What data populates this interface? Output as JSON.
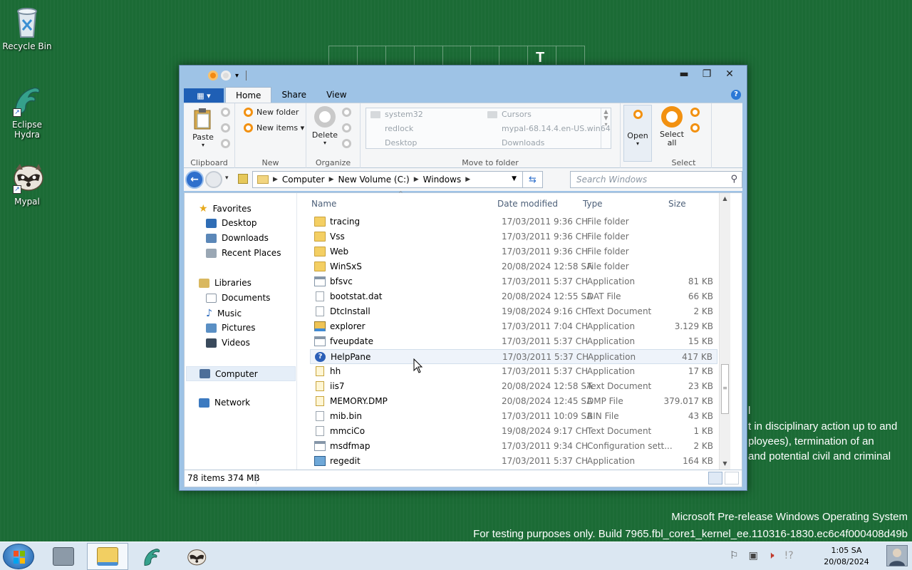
{
  "desktop": {
    "icons": [
      {
        "label": "Recycle Bin",
        "icon": "recycle-bin-icon"
      },
      {
        "label": "Eclipse Hydra",
        "icon": "eclipse-hydra-icon"
      },
      {
        "label": "Mypal",
        "icon": "mypal-raccoon-icon"
      }
    ],
    "bg_letter": "T",
    "bg_lines": [
      "l",
      "t in disciplinary action up to and",
      "ployees), termination of an",
      "and potential civil and criminal"
    ],
    "watermark_line1": "Microsoft Pre-release Windows Operating System",
    "watermark_line2": "For testing purposes only. Build 7965.fbl_core1_kernel_ee.110316-1830.ec6c4f000408d49b"
  },
  "window": {
    "title_buttons": {
      "minimize": "▬",
      "maximize": "❐",
      "close": "✕"
    },
    "ribbon_tabs": {
      "file": "▦ ▾",
      "home": "Home",
      "share": "Share",
      "view": "View"
    },
    "clipboard": {
      "paste": "Paste",
      "group": "Clipboard"
    },
    "new": {
      "new_folder": "New folder",
      "new_items": "New items ▾",
      "group": "New"
    },
    "organize": {
      "delete": "Delete",
      "group": "Organize"
    },
    "move_to": {
      "group": "Move to folder",
      "items": [
        "system32",
        "redlock",
        "Desktop",
        "Cursors",
        "mypal-68.14.4.en-US.win64",
        "Downloads"
      ]
    },
    "select": {
      "open": "Open",
      "select_all_1": "Select",
      "select_all_2": "all",
      "group": "Select"
    },
    "address": {
      "crumbs": [
        "Computer",
        "New Volume (C:)",
        "Windows"
      ],
      "search_placeholder": "Search Windows"
    },
    "nav_pane": {
      "favorites": "Favorites",
      "desktop": "Desktop",
      "downloads": "Downloads",
      "recent": "Recent Places",
      "libraries": "Libraries",
      "documents": "Documents",
      "music": "Music",
      "pictures": "Pictures",
      "videos": "Videos",
      "computer": "Computer",
      "network": "Network"
    },
    "columns": {
      "name": "Name",
      "date": "Date modified",
      "type": "Type",
      "size": "Size"
    },
    "files": [
      {
        "name": "tracing",
        "date": "17/03/2011 9:36 CH",
        "type": "File folder",
        "size": "",
        "icon": "folder"
      },
      {
        "name": "Vss",
        "date": "17/03/2011 9:36 CH",
        "type": "File folder",
        "size": "",
        "icon": "folder"
      },
      {
        "name": "Web",
        "date": "17/03/2011 9:36 CH",
        "type": "File folder",
        "size": "",
        "icon": "folder"
      },
      {
        "name": "WinSxS",
        "date": "20/08/2024 12:58 SA",
        "type": "File folder",
        "size": "",
        "icon": "folder"
      },
      {
        "name": "bfsvc",
        "date": "17/03/2011 5:37 CH",
        "type": "Application",
        "size": "81 KB",
        "icon": "app"
      },
      {
        "name": "bootstat.dat",
        "date": "20/08/2024 12:55 SA",
        "type": "DAT File",
        "size": "66 KB",
        "icon": "doc"
      },
      {
        "name": "DtcInstall",
        "date": "19/08/2024 9:16 CH",
        "type": "Text Document",
        "size": "2 KB",
        "icon": "doc"
      },
      {
        "name": "explorer",
        "date": "17/03/2011 7:04 CH",
        "type": "Application",
        "size": "3.129 KB",
        "icon": "explorer"
      },
      {
        "name": "fveupdate",
        "date": "17/03/2011 5:37 CH",
        "type": "Application",
        "size": "15 KB",
        "icon": "app"
      },
      {
        "name": "HelpPane",
        "date": "17/03/2011 5:37 CH",
        "type": "Application",
        "size": "417 KB",
        "icon": "help"
      },
      {
        "name": "hh",
        "date": "17/03/2011 5:37 CH",
        "type": "Application",
        "size": "17 KB",
        "icon": "lock"
      },
      {
        "name": "iis7",
        "date": "20/08/2024 12:58 SA",
        "type": "Text Document",
        "size": "23 KB",
        "icon": "lock"
      },
      {
        "name": "MEMORY.DMP",
        "date": "20/08/2024 12:45 SA",
        "type": "DMP File",
        "size": "379.017 KB",
        "icon": "lock"
      },
      {
        "name": "mib.bin",
        "date": "17/03/2011 10:09 SA",
        "type": "BIN File",
        "size": "43 KB",
        "icon": "doc"
      },
      {
        "name": "mmciCo",
        "date": "19/08/2024 9:17 CH",
        "type": "Text Document",
        "size": "1 KB",
        "icon": "doc"
      },
      {
        "name": "msdfmap",
        "date": "17/03/2011 9:34 CH",
        "type": "Configuration sett...",
        "size": "2 KB",
        "icon": "app"
      },
      {
        "name": "regedit",
        "date": "17/03/2011 5:37 CH",
        "type": "Application",
        "size": "164 KB",
        "icon": "reg"
      }
    ],
    "hovered_file": "HelpPane",
    "status": "78 items  374 MB"
  },
  "taskbar": {
    "apps": [
      "server-manager-icon",
      "file-explorer-icon",
      "eclipse-hydra-icon",
      "mypal-icon"
    ],
    "active_app": "file-explorer-icon",
    "time": "1:05 SA",
    "date": "20/08/2024"
  }
}
